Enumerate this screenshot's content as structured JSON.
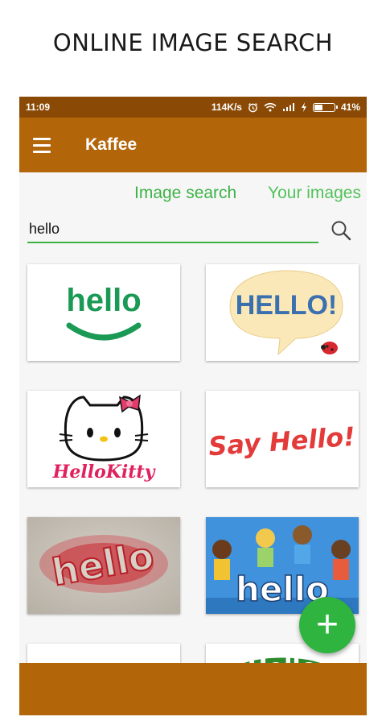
{
  "headline": "ONLINE IMAGE SEARCH",
  "status_bar": {
    "time": "11:09",
    "network_speed": "114K/s",
    "battery_percent": "41%",
    "battery_level": 0.41,
    "icons": [
      "alarm-icon",
      "wifi-icon",
      "signal-icon",
      "charging-icon",
      "battery-icon"
    ]
  },
  "app_bar": {
    "title": "Kaffee",
    "menu_icon": "hamburger-menu-icon"
  },
  "tabs": [
    {
      "label": "Image search",
      "selected": true
    },
    {
      "label": "Your images",
      "selected": false
    }
  ],
  "search": {
    "value": "hello",
    "placeholder": "",
    "button_icon": "search-icon"
  },
  "results": {
    "r1_text": "hello",
    "r2_text": "HELLO!",
    "r3_text": "HelloKitty",
    "r4_text": "Say Hello!",
    "r5_text": "hello",
    "r6_text": "hello",
    "r8_text": "Hello"
  },
  "fab": {
    "label": "+",
    "icon": "plus-icon"
  },
  "colors": {
    "status_bar": "#8a4a05",
    "app_bar": "#b3650a",
    "accent_green": "#3db346",
    "fab": "#2fb43f"
  }
}
